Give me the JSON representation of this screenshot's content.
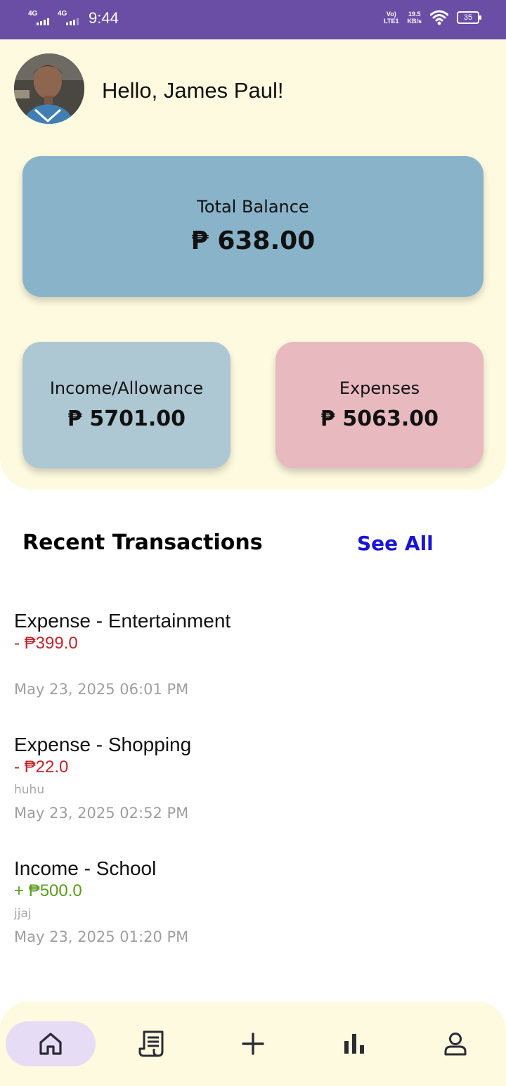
{
  "status_bar": {
    "network1": "4G",
    "network2": "4G",
    "time": "9:44",
    "volte_top": "Vo)",
    "volte_bottom": "LTE1",
    "speed_top": "19.5",
    "speed_bottom": "KB/s",
    "battery": "35"
  },
  "header": {
    "greeting": "Hello, James Paul!"
  },
  "balance": {
    "label": "Total Balance",
    "amount": "₱ 638.00"
  },
  "income": {
    "label": "Income/Allowance",
    "amount": "₱ 5701.00"
  },
  "expenses": {
    "label": "Expenses",
    "amount": "₱ 5063.00"
  },
  "recent": {
    "title": "Recent Transactions",
    "see_all": "See All",
    "items": [
      {
        "title": "Expense - Entertainment",
        "amount": "- ₱399.0",
        "note": "",
        "date": "May 23, 2025 06:01 PM"
      },
      {
        "title": "Expense - Shopping",
        "amount": "- ₱22.0",
        "note": "huhu",
        "date": "May 23, 2025 02:52 PM"
      },
      {
        "title": "Income - School",
        "amount": "+ ₱500.0",
        "note": "jjaj",
        "date": "May 23, 2025 01:20 PM"
      }
    ]
  },
  "nav": {
    "items": [
      {
        "icon": "home-icon",
        "active": true
      },
      {
        "icon": "receipt-icon",
        "active": false
      },
      {
        "icon": "plus-icon",
        "active": false
      },
      {
        "icon": "bar-chart-icon",
        "active": false
      },
      {
        "icon": "profile-icon",
        "active": false
      }
    ]
  },
  "colors": {
    "status_bar": "#6a4ea6",
    "panel": "#fefadf",
    "balance_card": "#89b3c8",
    "income_card": "#adc8d3",
    "expense_card": "#e8babf",
    "see_all": "#1a14d6",
    "negative": "#c0272d",
    "positive": "#5a9a1e",
    "nav_active": "#e6dcf5"
  }
}
